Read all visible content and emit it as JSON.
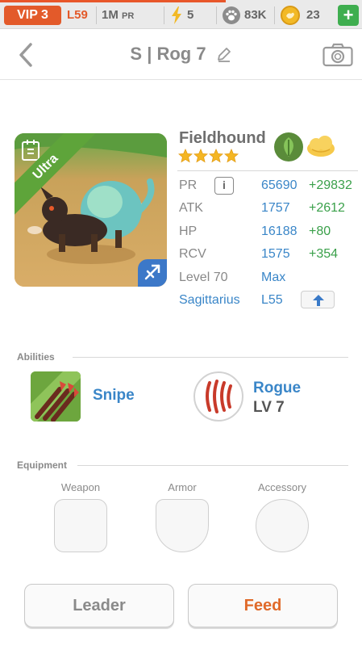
{
  "status_bar": {
    "vip_label": "VIP 3",
    "player_level": "L59",
    "power_rating_value": "1M",
    "power_rating_unit": "PR",
    "energy": "5",
    "paws": "83K",
    "coins": "23",
    "add_label": "+"
  },
  "header": {
    "title": "S | Rog 7"
  },
  "pet": {
    "rarity": "Ultra",
    "name": "Fieldhound",
    "stars": 4,
    "stats": [
      {
        "label": "PR",
        "value": "65690",
        "bonus": "+29832"
      },
      {
        "label": "ATK",
        "value": "1757",
        "bonus": "+2612"
      },
      {
        "label": "HP",
        "value": "16188",
        "bonus": "+80"
      },
      {
        "label": "RCV",
        "value": "1575",
        "bonus": "+354"
      }
    ],
    "level_label": "Level 70",
    "level_value": "Max",
    "constellation": "Sagittarius",
    "constellation_level": "L55",
    "info_label": "i",
    "colors": {
      "element_badge": "#3c78c8",
      "rarity_ribbon": "#5ea43a"
    }
  },
  "abilities": {
    "section_label": "Abilities",
    "ability_name": "Snipe",
    "class_name": "Rogue",
    "class_level": "LV 7"
  },
  "equipment": {
    "section_label": "Equipment",
    "slots": [
      "Weapon",
      "Armor",
      "Accessory"
    ]
  },
  "actions": {
    "leader_label": "Leader",
    "feed_label": "Feed"
  },
  "icons": {
    "back": "chevron-left-icon",
    "edit": "pencil-icon",
    "camera": "camera-icon",
    "energy": "lightning-icon",
    "paws": "paw-icon",
    "coins": "coin-icon",
    "journal": "journal-icon",
    "element": "sagittarius-arrow-icon",
    "leaf": "leaf-icon",
    "cloud": "cloud-icon",
    "upgrade": "arrow-up-icon"
  }
}
